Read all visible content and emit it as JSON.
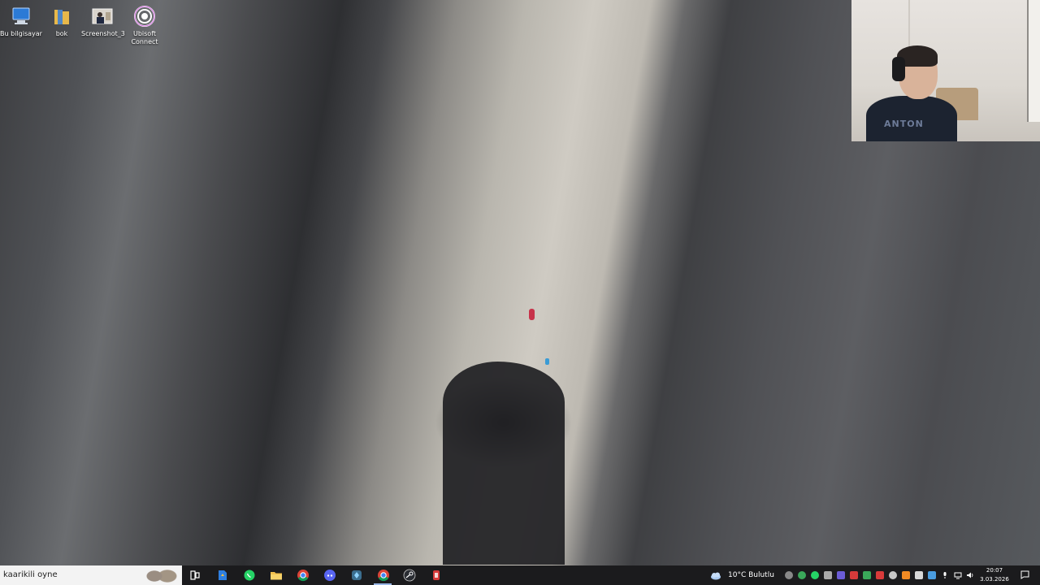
{
  "desktop_icons": [
    {
      "label": "Bu bilgisayar",
      "icon": "computer-icon"
    },
    {
      "label": "bok",
      "icon": "folder-icon"
    },
    {
      "label": "Screenshot_3",
      "icon": "image-file-icon"
    },
    {
      "label": "Ubisoft Connect",
      "icon": "ubisoft-icon"
    }
  ],
  "webcam": {
    "shirt_text": "ANTON"
  },
  "taskbar": {
    "search_text": "kaarikili oyne",
    "pinned": [
      "task-view-icon",
      "files-app-icon",
      "whatsapp-icon",
      "file-explorer-icon",
      "chrome-icon",
      "discord-icon",
      "game-launcher-icon",
      "chrome-active-icon",
      "steam-icon",
      "security-app-icon"
    ],
    "weather": "10°C  Bulutlu",
    "clock_time": "20:07",
    "clock_date": "3.03.2026"
  },
  "colors": {
    "taskbar_bg": "#1b1b1d",
    "accent": "#9ab7e6"
  }
}
